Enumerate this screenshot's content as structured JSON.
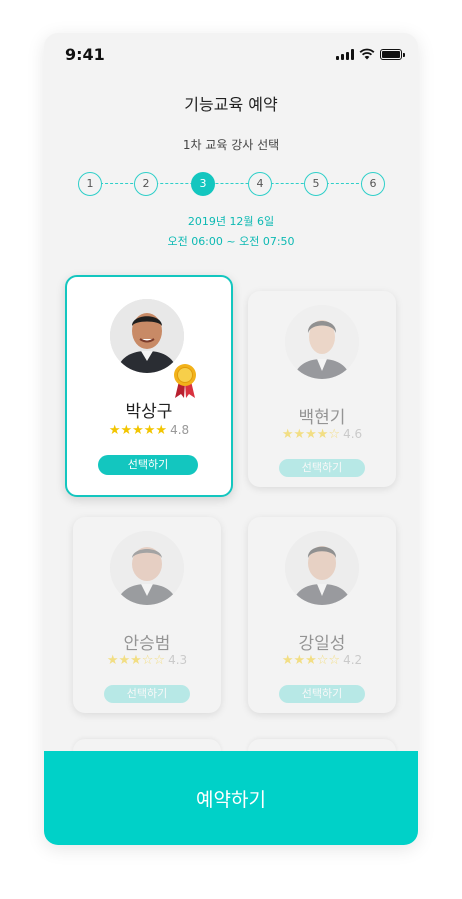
{
  "status": {
    "time": "9:41"
  },
  "header": {
    "title": "기능교육 예약",
    "subtitle": "1차 교육 강사 선택"
  },
  "stepper": {
    "steps": [
      "1",
      "2",
      "3",
      "4",
      "5",
      "6"
    ],
    "current": 3
  },
  "schedule": {
    "date": "2019년 12월 6일",
    "time": "오전 06:00 ~ 오전 07:50"
  },
  "instructors": [
    {
      "name": "박상구",
      "stars": "★★★★★",
      "score": "4.8",
      "button": "선택하기",
      "selected": true,
      "medal": true
    },
    {
      "name": "백현기",
      "stars": "★★★★☆",
      "score": "4.6",
      "button": "선택하기",
      "selected": false
    },
    {
      "name": "안승범",
      "stars": "★★★☆☆",
      "score": "4.3",
      "button": "선택하기",
      "selected": false
    },
    {
      "name": "강일성",
      "stars": "★★★☆☆",
      "score": "4.2",
      "button": "선택하기",
      "selected": false
    }
  ],
  "footer": {
    "book_label": "예약하기"
  },
  "colors": {
    "accent": "#13c6bf",
    "button": "#00d1c8",
    "star": "#f2c500"
  }
}
